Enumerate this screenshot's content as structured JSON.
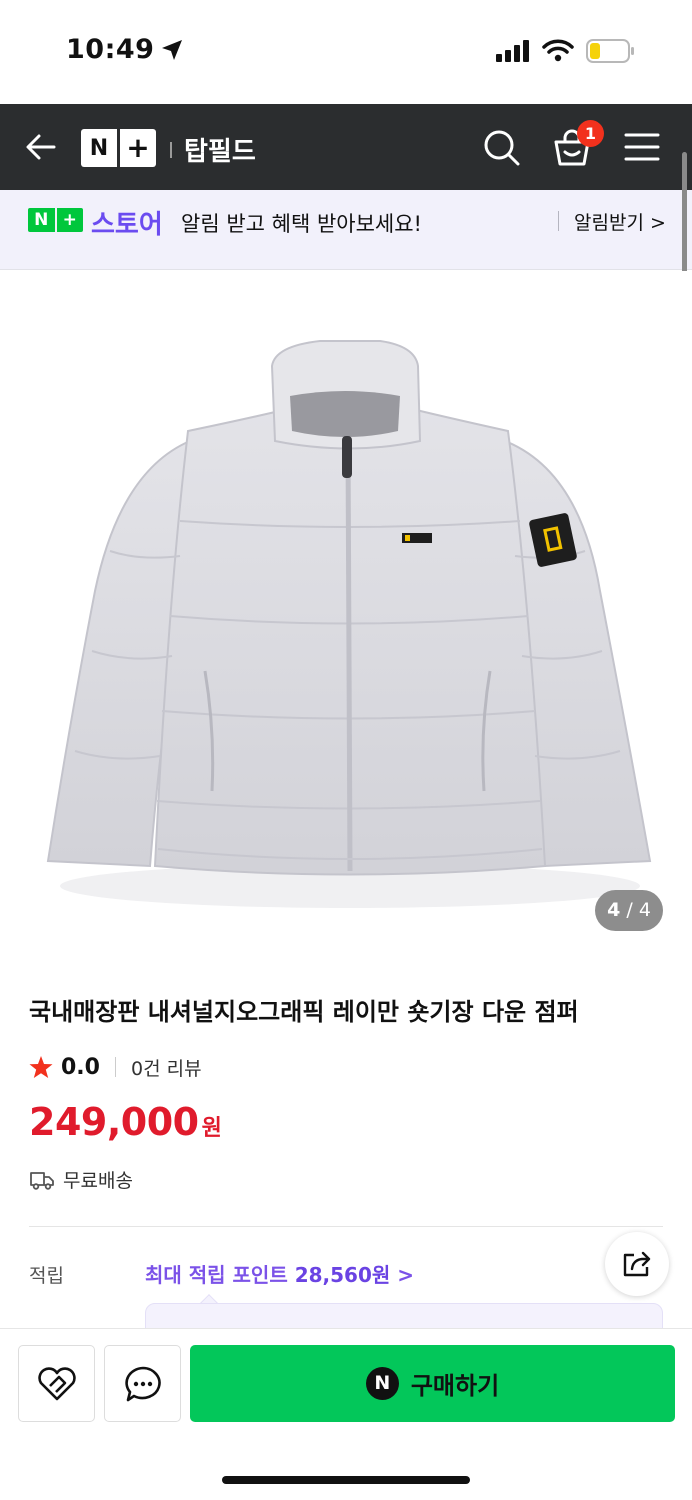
{
  "status_bar": {
    "time": "10:49"
  },
  "header": {
    "logo_n": "N",
    "logo_plus": "+",
    "store_name": "탑필드",
    "cart_count": "1"
  },
  "banner": {
    "badge_n": "N",
    "badge_plus": "+",
    "store_word": "스토어",
    "message": "알림 받고 혜택 받아보세요!",
    "cta": "알림받기 >"
  },
  "gallery": {
    "current": "4",
    "separator": "/",
    "total": "4"
  },
  "product": {
    "title": "국내매장판 내셔널지오그래픽 레이만 숏기장 다운 점퍼",
    "rating": "0.0",
    "reviews": "0건 리뷰",
    "price": "249,000",
    "currency": "원",
    "shipping": "무료배송"
  },
  "points": {
    "label": "적립",
    "prefix": "최대 적립 포인트 ",
    "amount": "28,560원",
    "arrow": ">"
  },
  "bottom_bar": {
    "buy_icon": "N",
    "buy_label": "구매하기"
  },
  "colors": {
    "header_bg": "#2b2d2f",
    "naver_green": "#03c75a",
    "price_red": "#e01b2c",
    "accent_purple": "#7b52e8",
    "badge_red": "#f2311d"
  }
}
